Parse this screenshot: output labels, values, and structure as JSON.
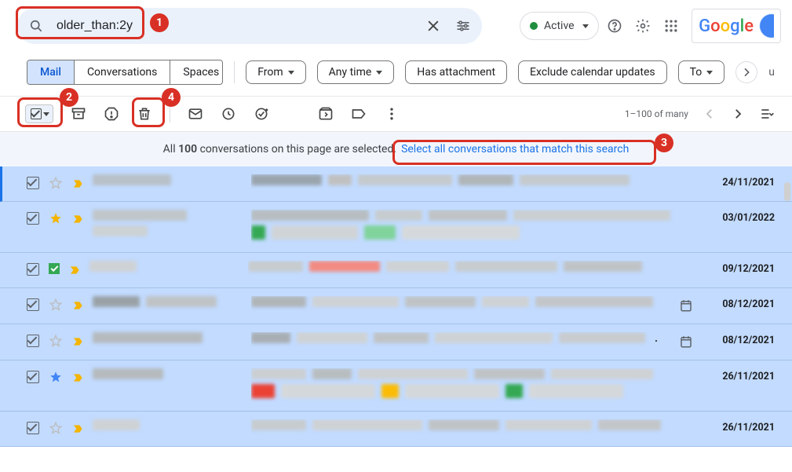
{
  "search": {
    "query": "older_than:2y"
  },
  "status": {
    "label": "Active"
  },
  "logo": "Google",
  "tabs": {
    "mail": "Mail",
    "conversations": "Conversations",
    "spaces": "Spaces"
  },
  "chips": {
    "from": "From",
    "anytime": "Any time",
    "attach": "Has attachment",
    "exclude": "Exclude calendar updates",
    "to": "To",
    "unread": "u"
  },
  "toolbar": {
    "pager": "1–100 of many"
  },
  "banner": {
    "pre": "All ",
    "count": "100",
    "mid": " conversations on this page are selected. ",
    "link": "Select all conversations that match this search"
  },
  "markers": {
    "m1": "1",
    "m2": "2",
    "m3": "3",
    "m4": "4"
  },
  "rows": [
    {
      "date": "24/11/2021",
      "star": "plain",
      "imp": "yellow",
      "cal": false
    },
    {
      "date": "03/01/2022",
      "star": "y",
      "imp": "yellow",
      "cal": false
    },
    {
      "date": "09/12/2021",
      "star": "green",
      "imp": "yellow",
      "cal": false
    },
    {
      "date": "08/12/2021",
      "star": "plain",
      "imp": "yellow",
      "cal": true
    },
    {
      "date": "08/12/2021",
      "star": "plain",
      "imp": "yellow",
      "cal": true
    },
    {
      "date": "26/11/2021",
      "star": "b",
      "imp": "yellow",
      "cal": false
    },
    {
      "date": "26/11/2021",
      "star": "plain",
      "imp": "yellow",
      "cal": false
    }
  ]
}
